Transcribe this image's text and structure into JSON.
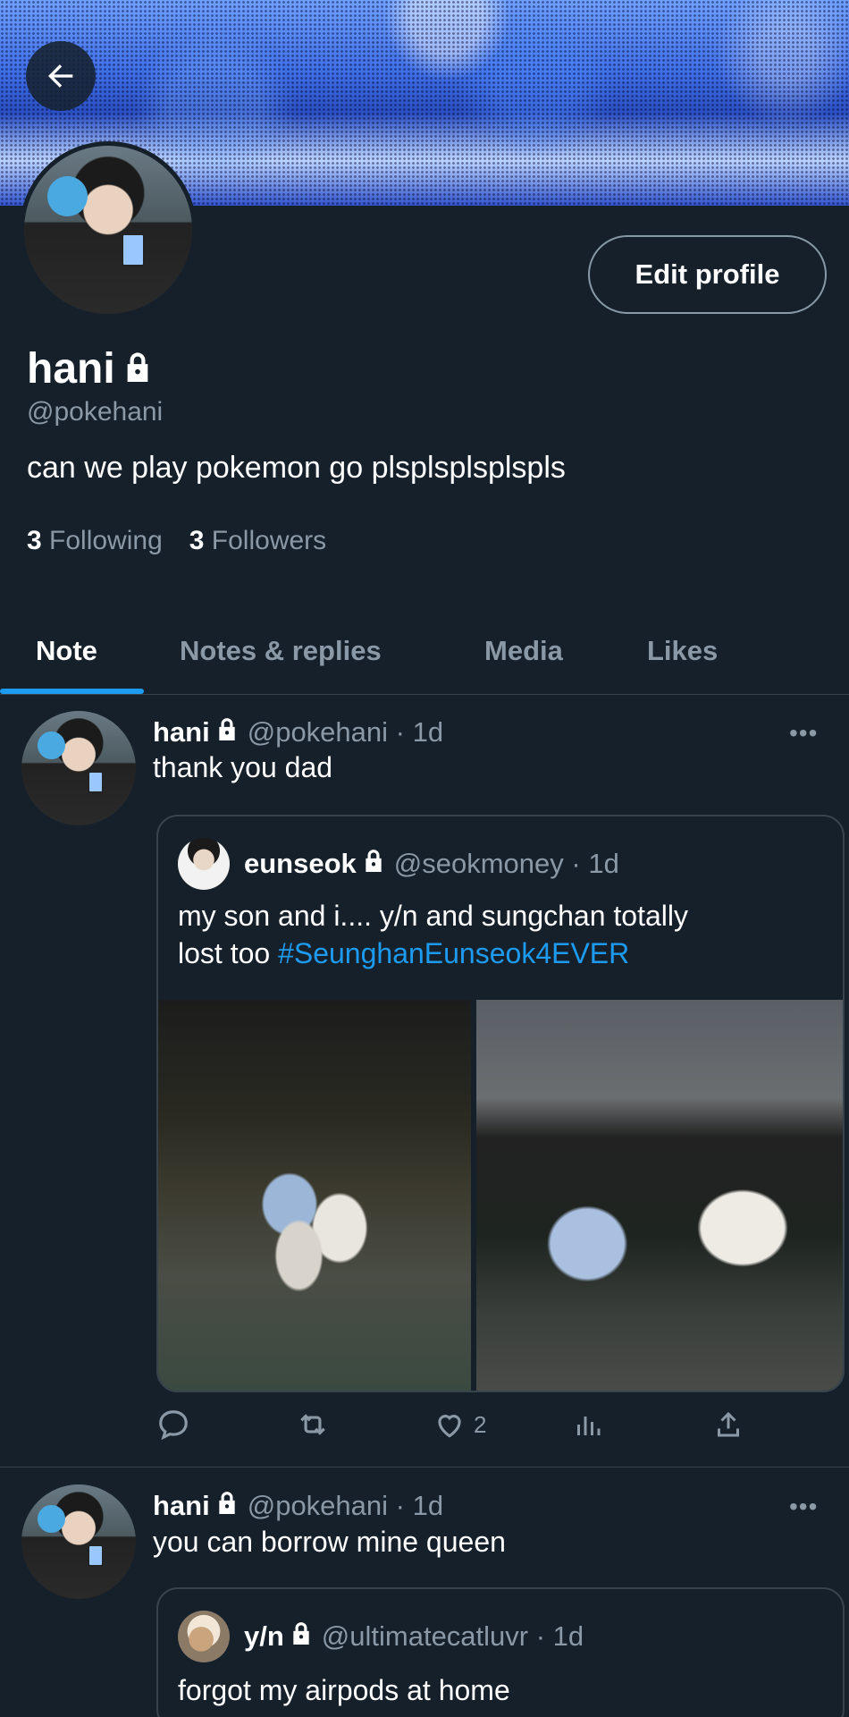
{
  "profile": {
    "name": "hani",
    "handle": "@pokehani",
    "bio": "can we play pokemon go plsplsplsplspls",
    "following_count": "3",
    "following_label": "Following",
    "followers_count": "3",
    "followers_label": "Followers",
    "edit_button": "Edit profile"
  },
  "tabs": [
    {
      "label": "Note",
      "active": true
    },
    {
      "label": "Notes & replies",
      "active": false
    },
    {
      "label": "Media",
      "active": false
    },
    {
      "label": "Likes",
      "active": false
    }
  ],
  "posts": [
    {
      "name": "hani",
      "meta": "@pokehani · 1d",
      "text": "thank you dad",
      "quote": {
        "name": "eunseok",
        "meta": "@seokmoney · 1d",
        "text_line1": "my son and i.... y/n and sungchan totally",
        "text_line2_prefix": "lost too ",
        "hashtag": "#SeunghanEunseok4EVER"
      },
      "like_count": "2"
    },
    {
      "name": "hani",
      "meta": "@pokehani · 1d",
      "text": "you can borrow mine queen",
      "quote": {
        "name": "y/n",
        "meta": "@ultimatecatluvr · 1d",
        "text": "forgot my airpods at home"
      }
    }
  ],
  "more_glyph": "•••",
  "colors": {
    "background": "#15202b",
    "accent": "#1d9bf0",
    "muted_text": "#8b98a5",
    "border": "#38444d"
  },
  "icons": [
    "back-arrow-icon",
    "lock-icon",
    "more-icon",
    "reply-icon",
    "retweet-icon",
    "heart-icon",
    "analytics-icon",
    "share-icon"
  ]
}
